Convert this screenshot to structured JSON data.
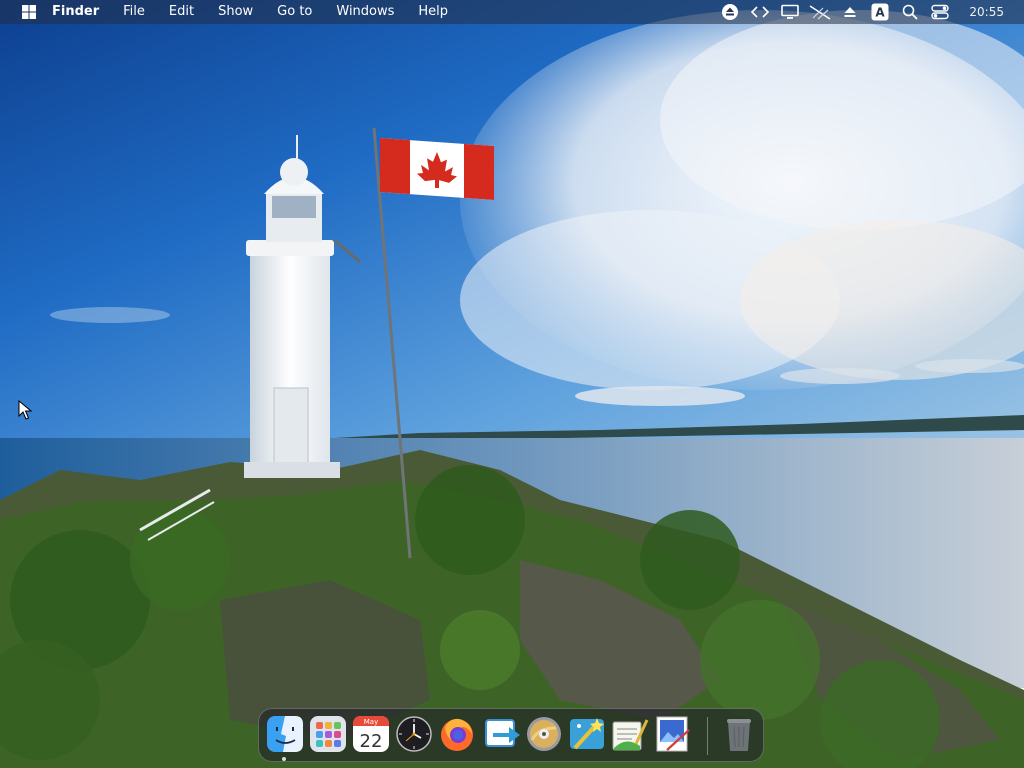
{
  "menubar": {
    "app_name": "Finder",
    "items": [
      "File",
      "Edit",
      "Show",
      "Go to",
      "Windows",
      "Help"
    ],
    "clock": "20:55",
    "status_icons": [
      "eject-icon",
      "code-brackets-icon",
      "display-icon",
      "network-off-icon",
      "eject-alt-icon",
      "keyboard-layout-icon",
      "search-icon",
      "control-center-icon"
    ],
    "keyboard_layout": "A"
  },
  "calendar": {
    "month": "May",
    "day": "22"
  },
  "dock": {
    "apps": [
      "finder-icon",
      "launchpad-icon",
      "calendar-icon",
      "clock-icon",
      "firefox-icon",
      "migration-icon",
      "dvd-player-icon",
      "magic-wand-icon",
      "script-editor-icon",
      "preview-icon",
      "trash-icon"
    ]
  },
  "colors": {
    "sky_top": "#1f5fb8",
    "sky_horizon": "#6fb0e3",
    "sea": "#3e76a8",
    "vegetation": "#3f6a2a",
    "menubar_bg": "#2a3550",
    "flag_red": "#d52b1e"
  }
}
